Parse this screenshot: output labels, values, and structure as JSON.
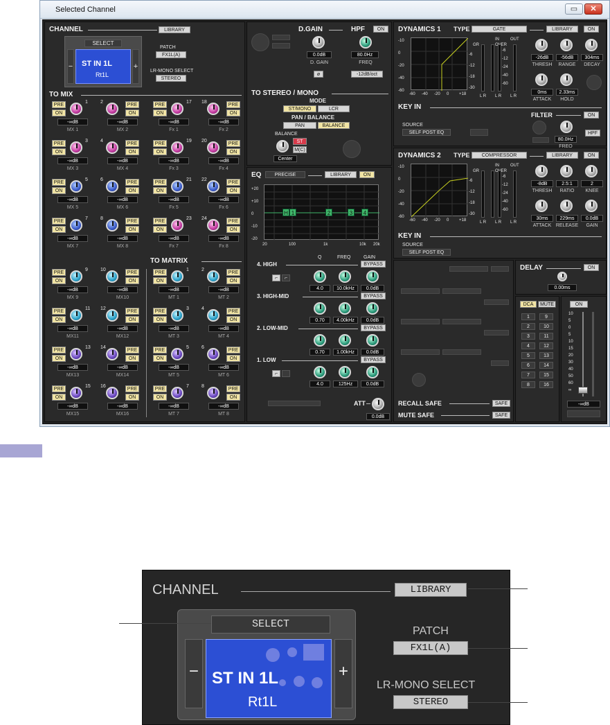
{
  "window": {
    "title": "Selected Channel",
    "minimize": "▭",
    "close": "✕"
  },
  "channel": {
    "header": "CHANNEL",
    "library": "LIBRARY",
    "select": "SELECT",
    "name": "ST IN 1L",
    "short_name": "Rt1L",
    "patch_label": "PATCH",
    "patch_value": "FX1L(A)",
    "lr_mono_label": "LR-MONO SELECT",
    "lr_mono_value": "STEREO",
    "minus": "−",
    "plus": "+"
  },
  "to_mix": {
    "header": "TO MIX",
    "pre": "PRE",
    "on": "ON",
    "level": "-∞dB",
    "rows": [
      [
        {
          "n": "1",
          "name": "MX 1",
          "c": "pink"
        },
        {
          "n": "2",
          "name": "MX 2",
          "c": "pink"
        },
        {
          "n": "17",
          "name": "Fx 1",
          "c": "pink"
        },
        {
          "n": "18",
          "name": "Fx 2",
          "c": "pink"
        }
      ],
      [
        {
          "n": "3",
          "name": "MX 3",
          "c": "pink"
        },
        {
          "n": "4",
          "name": "MX 4",
          "c": "pink"
        },
        {
          "n": "19",
          "name": "Fx 3",
          "c": "pink"
        },
        {
          "n": "20",
          "name": "Fx 4",
          "c": "pink"
        }
      ],
      [
        {
          "n": "5",
          "name": "MX 5",
          "c": "blue"
        },
        {
          "n": "6",
          "name": "MX 6",
          "c": "blue"
        },
        {
          "n": "21",
          "name": "Fx 5",
          "c": "blue"
        },
        {
          "n": "22",
          "name": "Fx 6",
          "c": "blue"
        }
      ],
      [
        {
          "n": "7",
          "name": "MX 7",
          "c": "blue"
        },
        {
          "n": "8",
          "name": "MX 8",
          "c": "blue"
        },
        {
          "n": "23",
          "name": "Fx 7",
          "c": "pink"
        },
        {
          "n": "24",
          "name": "Fx 8",
          "c": "pink"
        }
      ],
      [
        {
          "n": "9",
          "name": "MX 9",
          "c": "cyan"
        },
        {
          "n": "10",
          "name": "MX10",
          "c": "cyan"
        },
        {
          "n": "1",
          "name": "MT 1",
          "c": "cyan"
        },
        {
          "n": "2",
          "name": "MT 2",
          "c": "cyan"
        }
      ],
      [
        {
          "n": "11",
          "name": "MX11",
          "c": "cyan"
        },
        {
          "n": "12",
          "name": "MX12",
          "c": "cyan"
        },
        {
          "n": "3",
          "name": "MT 3",
          "c": "cyan"
        },
        {
          "n": "4",
          "name": "MT 4",
          "c": "cyan"
        }
      ],
      [
        {
          "n": "13",
          "name": "MX13",
          "c": "purple"
        },
        {
          "n": "14",
          "name": "MX14",
          "c": "purple"
        },
        {
          "n": "5",
          "name": "MT 5",
          "c": "purple"
        },
        {
          "n": "6",
          "name": "MT 6",
          "c": "purple"
        }
      ],
      [
        {
          "n": "15",
          "name": "MX15",
          "c": "purple"
        },
        {
          "n": "16",
          "name": "MX16",
          "c": "purple"
        },
        {
          "n": "7",
          "name": "MT 7",
          "c": "purple"
        },
        {
          "n": "8",
          "name": "MT 8",
          "c": "purple"
        }
      ]
    ]
  },
  "to_matrix": {
    "header": "TO MATRIX"
  },
  "dgain": {
    "header": "D.GAIN",
    "value": "0.0dB",
    "label": "D. GAIN",
    "phase": "ø"
  },
  "hpf": {
    "header": "HPF",
    "on": "ON",
    "value": "80.0Hz",
    "label": "FREQ",
    "slope": "-12dB/oct"
  },
  "to_stereo": {
    "header": "TO STEREO / MONO",
    "mode_label": "MODE",
    "st_mono": "ST/MONO",
    "lcr": "LCR",
    "pan_balance_label": "PAN / BALANCE",
    "pan": "PAN",
    "balance": "BALANCE",
    "balance_label": "BALANCE",
    "st": "ST",
    "mono": "M(C)",
    "center": "Center"
  },
  "eq": {
    "header": "EQ",
    "type": "PRECISE",
    "library": "LIBRARY",
    "on": "ON",
    "y_ticks": [
      "+20",
      "+10",
      "0",
      "-10",
      "-20"
    ],
    "x_ticks": [
      "20",
      "100",
      "1k",
      "10k",
      "20k"
    ],
    "col_q": "Q",
    "col_freq": "FREQ",
    "col_gain": "GAIN",
    "bypass": "BYPASS",
    "bands": [
      {
        "name": "4. HIGH",
        "q": "4.0",
        "freq": "10.0kHz",
        "gain": "0.0dB"
      },
      {
        "name": "3. HIGH-MID",
        "q": "0.70",
        "freq": "4.00kHz",
        "gain": "0.0dB"
      },
      {
        "name": "2. LOW-MID",
        "q": "0.70",
        "freq": "1.00kHz",
        "gain": "0.0dB"
      },
      {
        "name": "1. LOW",
        "q": "4.0",
        "freq": "125Hz",
        "gain": "0.0dB"
      }
    ],
    "markers": [
      "H",
      "1",
      "2",
      "3",
      "4"
    ],
    "att_label": "ATT",
    "att_value": "0.0dB"
  },
  "dyn1": {
    "header": "DYNAMICS 1",
    "type_label": "TYPE",
    "type": "GATE",
    "library": "LIBRARY",
    "on": "ON",
    "graph_y": [
      "-10",
      "0",
      "-20",
      "-40",
      "-60"
    ],
    "graph_x": [
      "-60",
      "-40",
      "-20",
      "0",
      "+18"
    ],
    "gr": "GR",
    "in": "IN",
    "out": "OUT",
    "over": "OVER",
    "scale": [
      "-6",
      "-12",
      "-18",
      "-30"
    ],
    "scale2": [
      "-6",
      "-12",
      "-24",
      "-40",
      "-60"
    ],
    "lr": "L R",
    "knobs": [
      {
        "label": "THRESH",
        "value": "-26dB"
      },
      {
        "label": "RANGE",
        "value": "-56dB"
      },
      {
        "label": "DECAY",
        "value": "304ms"
      },
      {
        "label": "ATTACK",
        "value": "0ms"
      },
      {
        "label": "HOLD",
        "value": "2.33ms"
      }
    ],
    "key_in": "KEY IN",
    "source_label": "SOURCE",
    "source": "SELF POST EQ",
    "filter": "FILTER",
    "filter_on": "ON",
    "filter_freq": "80.0Hz",
    "filter_label": "FREQ",
    "hpf": "HPF"
  },
  "dyn2": {
    "header": "DYNAMICS 2",
    "type_label": "TYPE",
    "type": "COMPRESSOR",
    "library": "LIBRARY",
    "on": "ON",
    "knobs": [
      {
        "label": "THRESH",
        "value": "-8dB"
      },
      {
        "label": "RATIO",
        "value": "2.5:1"
      },
      {
        "label": "KNEE",
        "value": "2"
      },
      {
        "label": "ATTACK",
        "value": "30ms"
      },
      {
        "label": "RELEASE",
        "value": "229ms"
      },
      {
        "label": "GAIN",
        "value": "0.0dB"
      }
    ],
    "key_in": "KEY IN",
    "source_label": "SOURCE",
    "source": "SELF POST EQ"
  },
  "delay": {
    "header": "DELAY",
    "on": "ON",
    "value": "0.00ms"
  },
  "dca": {
    "dca": "DCA",
    "mute": "MUTE",
    "left": [
      "1",
      "2",
      "3",
      "4",
      "5",
      "6",
      "7",
      "8"
    ],
    "right": [
      "9",
      "10",
      "11",
      "12",
      "13",
      "14",
      "15",
      "16"
    ]
  },
  "fader": {
    "on": "ON",
    "scale": [
      "10",
      "5",
      "0",
      "5",
      "10",
      "15",
      "20",
      "30",
      "40",
      "50",
      "60",
      "∞"
    ],
    "value": "-∞dB"
  },
  "safe": {
    "recall": "RECALL SAFE",
    "mute": "MUTE SAFE",
    "btn": "SAFE"
  },
  "colors": {
    "pink": "#c23aa0",
    "blue": "#3a5ac8",
    "cyan": "#2aa0c8",
    "purple": "#6a48c0",
    "curve": "#c8d020",
    "eq_green": "#3fb86a",
    "channel_blue": "#2c4fd4"
  }
}
